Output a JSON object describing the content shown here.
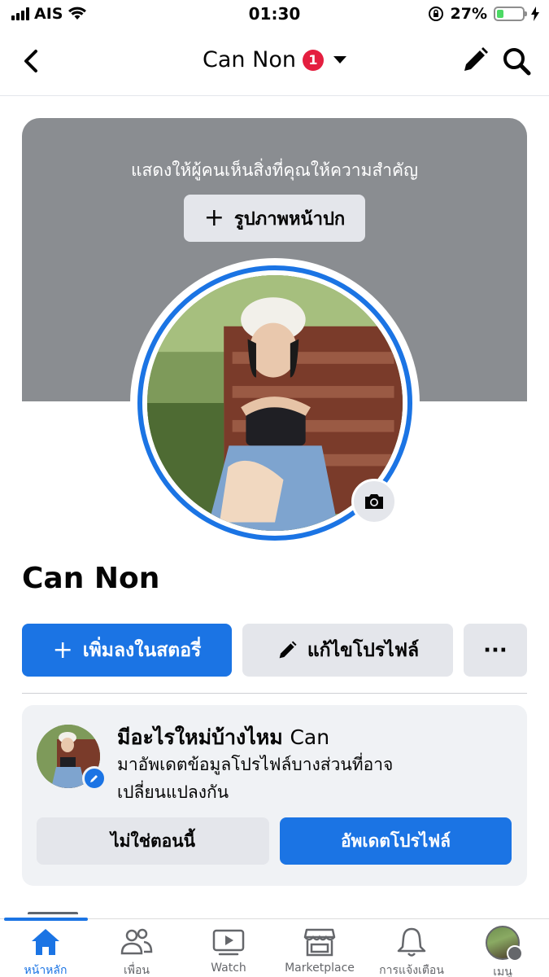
{
  "status_bar": {
    "carrier": "AIS",
    "time": "01:30",
    "battery": "27%",
    "battery_level": 0.27
  },
  "header": {
    "title": "Can Non",
    "badge_count": "1"
  },
  "cover": {
    "prompt": "แสดงให้ผู้คนเห็นสิ่งที่คุณให้ความสำคัญ",
    "add_cover_label": "รูปภาพหน้าปก"
  },
  "profile": {
    "name": "Can Non"
  },
  "actions": {
    "add_story_label": "เพิ่มลงในสตอรี่",
    "edit_profile_label": "แก้ไขโปรไฟล์",
    "more_label": "···"
  },
  "update_card": {
    "title_prefix": "มีอะไรใหม่บ้างไหม",
    "title_name": "Can",
    "description": "มาอัพเดตข้อมูลโปรไฟล์บางส่วนที่อาจเปลี่ยนแปลงกัน",
    "not_now_label": "ไม่ใช่ตอนนี้",
    "update_label": "อัพเดตโปรไฟล์"
  },
  "tabs": [
    {
      "label": "หน้าหลัก",
      "icon": "home-icon",
      "active": true
    },
    {
      "label": "เพื่อน",
      "icon": "friends-icon",
      "active": false
    },
    {
      "label": "Watch",
      "icon": "watch-icon",
      "active": false
    },
    {
      "label": "Marketplace",
      "icon": "marketplace-icon",
      "active": false
    },
    {
      "label": "การแจ้งเตือน",
      "icon": "bell-icon",
      "active": false
    },
    {
      "label": "เมนู",
      "icon": "menu-avatar",
      "active": false
    }
  ],
  "colors": {
    "accent": "#1b74e4",
    "badge": "#e41e3f",
    "cover_gray": "#8a8d91",
    "button_gray": "#e4e6eb"
  }
}
